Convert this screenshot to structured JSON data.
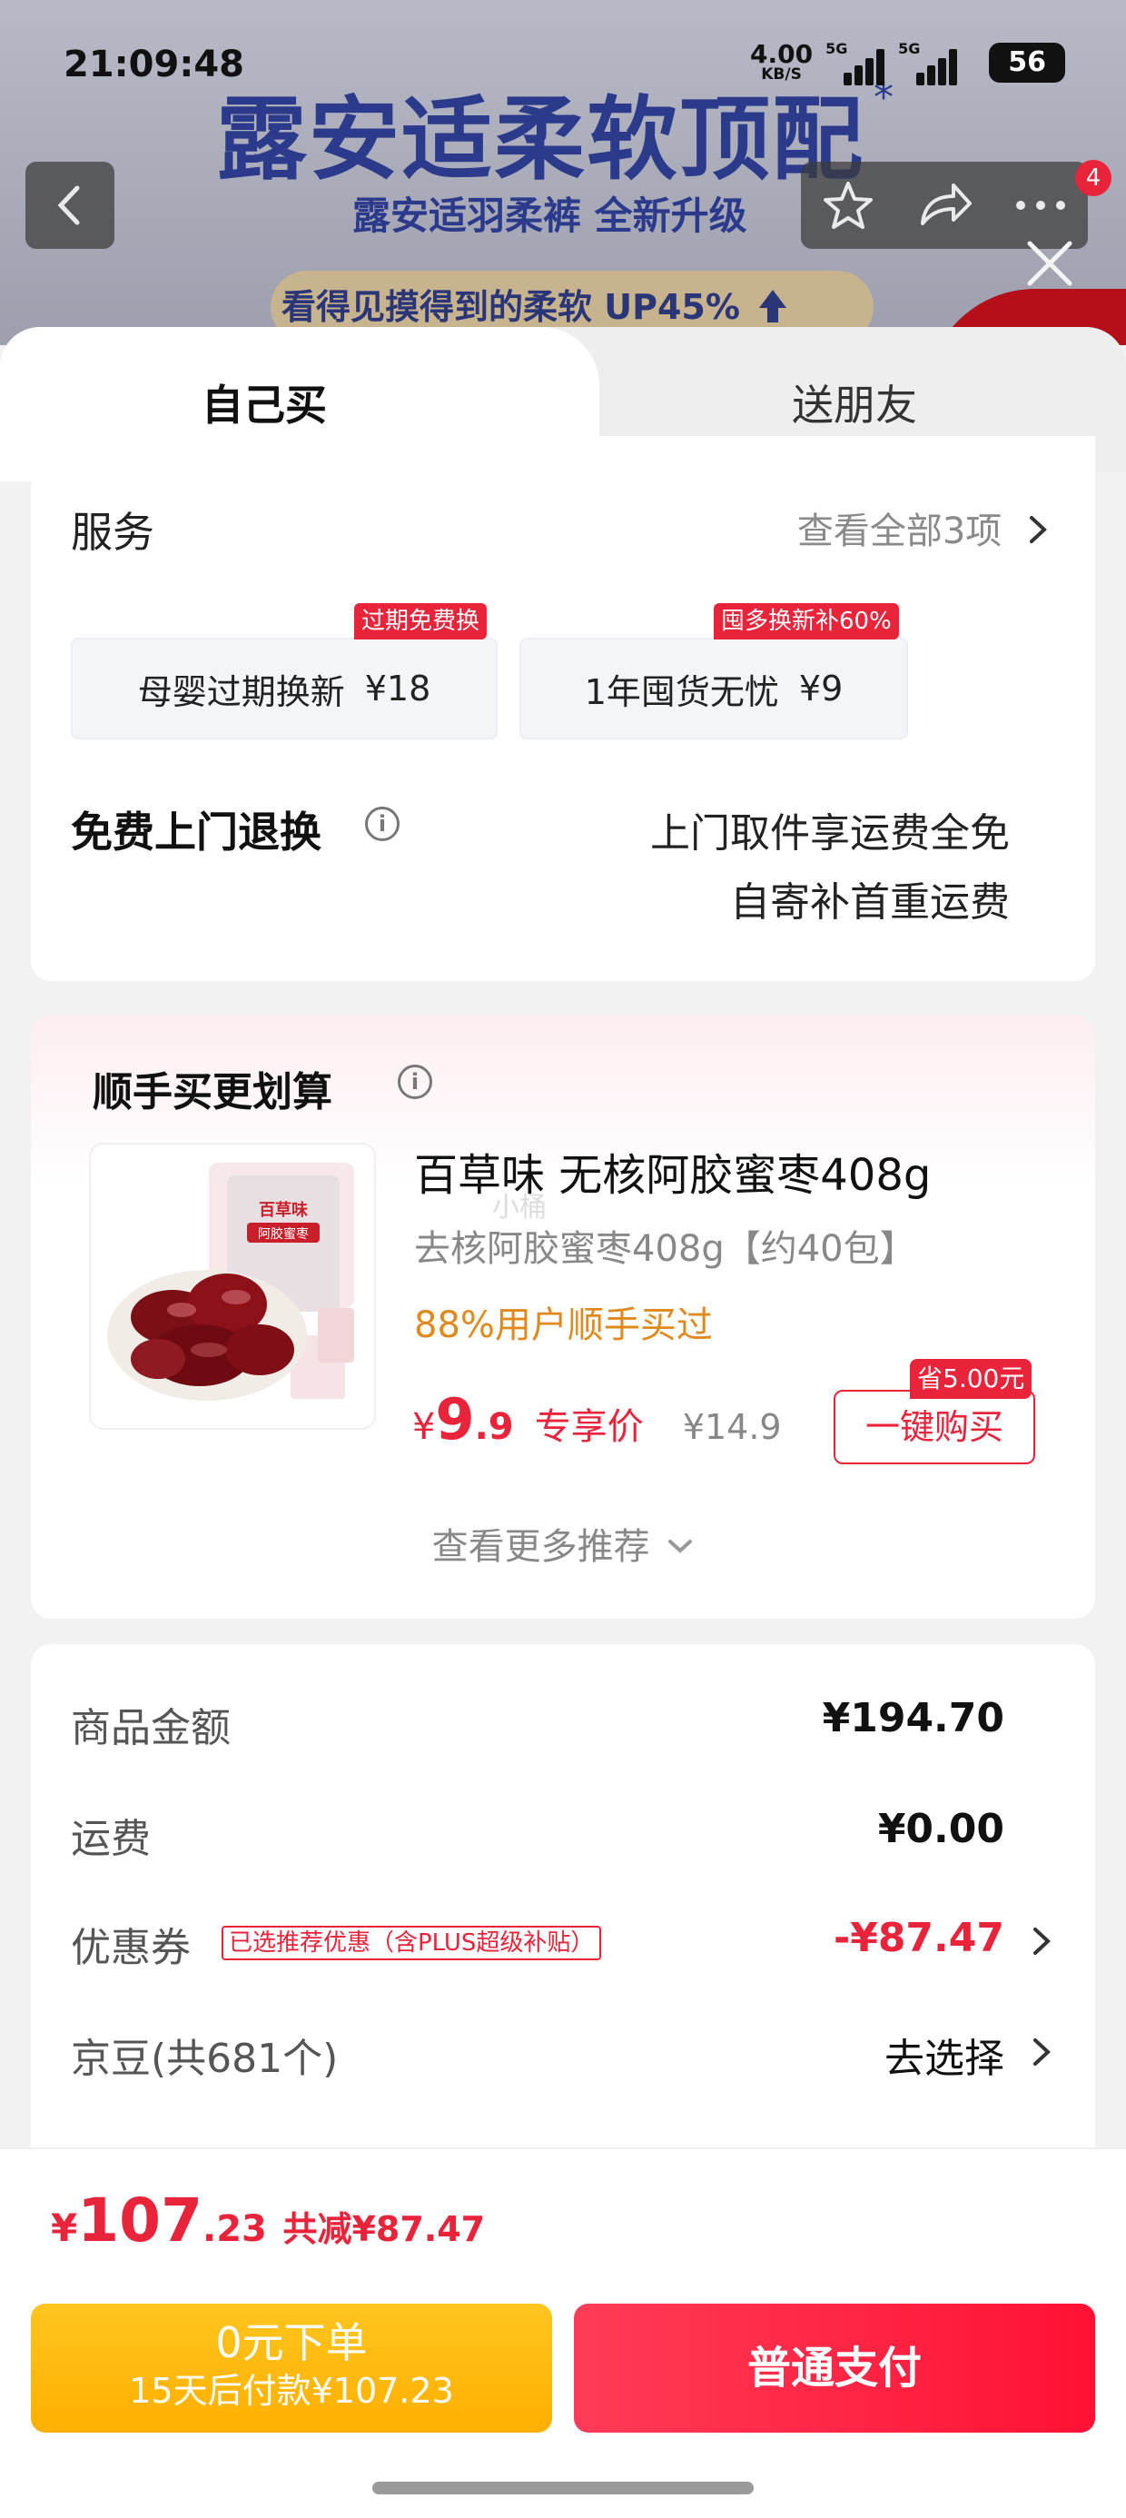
{
  "status_bar": {
    "time": "21:09:48",
    "net_speed_value": "4.00",
    "net_speed_unit": "KB/S",
    "signal_1_label": "5G",
    "signal_2_label": "5G",
    "battery": "56"
  },
  "background": {
    "headline": "露安适柔软顶配",
    "headline_mark": "*",
    "subline": "露安适羽柔裤 全新升级",
    "promo_text": "看得见摸得到的",
    "promo_highlight": "柔软 UP45%",
    "notification_count": "4"
  },
  "tabs": [
    {
      "label": "自己买",
      "active": true
    },
    {
      "label": "送朋友",
      "active": false
    }
  ],
  "service": {
    "title": "服务",
    "view_all": "查看全部3项",
    "options": [
      {
        "label": "母婴过期换新",
        "price": "¥18",
        "tag": "过期免费换"
      },
      {
        "label": "1年囤货无忧",
        "price": "¥9",
        "tag": "囤多换新补60%"
      }
    ],
    "return_title": "免费上门退换",
    "return_line1": "上门取件享运费全免",
    "return_line2": "自寄补首重运费"
  },
  "bundle": {
    "title": "顺手买更划算",
    "product_name": "百草味 无核阿胶蜜枣408g",
    "product_spec": "去核阿胶蜜枣408g【约40包】",
    "popularity": "88%用户顺手买过",
    "price_symbol": "¥",
    "price_int": "9",
    "price_dec": ".9",
    "price_label": "专享价",
    "original_price": "¥14.9",
    "save_tag": "省5.00元",
    "buy_button": "一键购买",
    "watermark": "小桶",
    "image_package_brand": "百草味",
    "image_package_name": "阿胶蜜枣",
    "more": "查看更多推荐"
  },
  "summary": {
    "rows": [
      {
        "label": "商品金额",
        "value": "¥194.70"
      },
      {
        "label": "运费",
        "value": "¥0.00"
      },
      {
        "label": "优惠券",
        "tag": "已选推荐优惠（含PLUS超级补贴）",
        "value": "-¥87.47"
      },
      {
        "label": "京豆(共681个)",
        "value": "去选择"
      }
    ]
  },
  "footer": {
    "total_symbol": "¥",
    "total_int": "107",
    "total_dec": ".23",
    "discount_text": "共减¥87.47",
    "btn_later_title": "0元下单",
    "btn_later_sub": "15天后付款¥107.23",
    "btn_pay": "普通支付"
  },
  "colors": {
    "accent_red": "#e8233a",
    "accent_orange": "#e08a1e",
    "btn_yellow": "#ffb800"
  }
}
